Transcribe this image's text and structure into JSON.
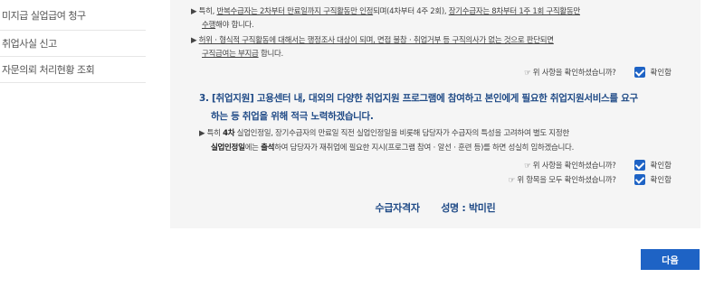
{
  "sidebar": {
    "items": [
      {
        "label": "미지급 실업급여 청구"
      },
      {
        "label": "취업사실 신고"
      },
      {
        "label": "자문의뢰 처리현황 조회"
      }
    ]
  },
  "section2": {
    "note1_a": "▶ 특히, ",
    "note1_b": "반복수급자는 2차부터 만료일까지 구직활동만 인정",
    "note1_c": "되며(4차부터 4주 2회), ",
    "note1_d": "장기수급자는 8차부터 1주 1회 구직활동만",
    "note1_e": "수행",
    "note1_f": "해야 합니다.",
    "note2_a": "▶ ",
    "note2_b": "허위ㆍ형식적 구직활동에 대해서는 행정조사 대상이 되며, 면접 불참ㆍ취업거부 등 구직의사가 없는 것으로 판단되면",
    "note2_c": "구직급여는 부지급",
    "note2_d": " 합니다.",
    "confirm_question": "☞ 위 사항을 확인하셨습니까?",
    "confirm_label": "확인함"
  },
  "section3": {
    "heading_line1": "3. [취업지원] 고용센터 내, 대외의 다양한 취업지원 프로그램에 참여하고 본인에게 필요한 취업지원서비스를 요구",
    "heading_line2": "하는 등 취업을 위해 적극 노력하겠습니다.",
    "note_a": "▶ 특히 ",
    "note_b": "4차",
    "note_c": " 실업인정일, 장기수급자의 만료일 직전 실업인정일을 비롯해 담당자가 수급자의 특성을 고려하여 별도 지정한",
    "note_d": "실업인정일",
    "note_e": "에는 ",
    "note_f": "출석",
    "note_g": "하여 담당자가 재취업에 필요한 지시(프로그램 참여ㆍ알선ㆍ훈련 등)를 하면 성실히 임하겠습니다.",
    "confirm_question": "☞ 위 사항을 확인하셨습니까?",
    "confirm_label": "확인함",
    "all_confirm_question": "☞ 위 항목을 모두 확인하셨습니까?",
    "all_confirm_label": "확인함"
  },
  "signature": {
    "role": "수급자격자",
    "name_label": "성명 : 박미린"
  },
  "next_button": "다음"
}
